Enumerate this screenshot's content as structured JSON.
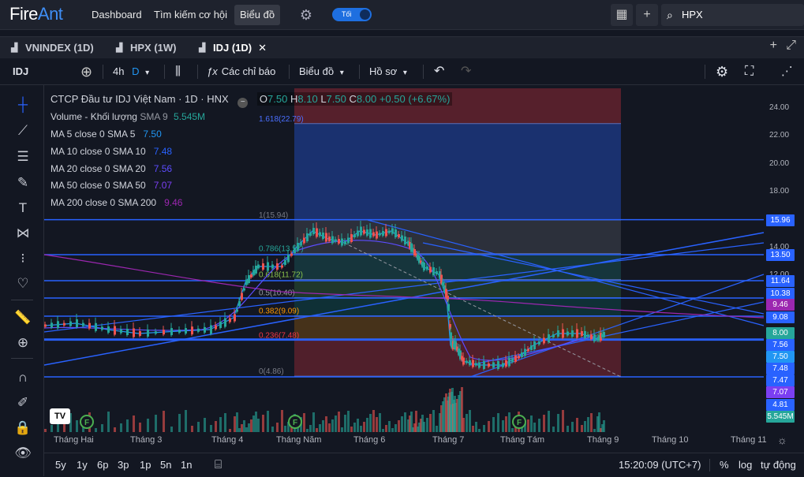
{
  "app": {
    "logo_a": "Fire",
    "logo_b": "Ant"
  },
  "topnav": {
    "dashboard": "Dashboard",
    "screener": "Tìm kiếm cơ hội",
    "chart": "Biểu đồ",
    "theme_toggle": "Tối"
  },
  "search": {
    "value": "HPX",
    "icon": "search-icon"
  },
  "tabs": [
    {
      "label": "VNINDEX (1D)"
    },
    {
      "label": "HPX (1W)"
    },
    {
      "label": "IDJ (1D)"
    }
  ],
  "toolbar": {
    "symbol": "IDJ",
    "interval": "4h",
    "interval_suffix": "D",
    "indicators": "Các chỉ báo",
    "chart_menu": "Biểu đồ",
    "profile": "Hồ sơ"
  },
  "legend": {
    "title": "CTCP Đầu tư IDJ Việt Nam · 1D · HNX",
    "o_label": "O",
    "o": "7.50",
    "h_label": "H",
    "h": "8.10",
    "l_label": "L",
    "l": "7.50",
    "c_label": "C",
    "c": "8.00",
    "change": "+0.50 (+6.67%)",
    "volume_label": "Volume - Khối lượng",
    "volume_sma": "SMA 9",
    "volume_value": "5.545M",
    "ma": [
      {
        "label": "MA 5 close 0 SMA 5",
        "value": "7.50",
        "color": "#2196f3"
      },
      {
        "label": "MA 10 close 0 SMA 10",
        "value": "7.48",
        "color": "#2962ff"
      },
      {
        "label": "MA 20 close 0 SMA 20",
        "value": "7.56",
        "color": "#5c4cff"
      },
      {
        "label": "MA 50 close 0 SMA 50",
        "value": "7.07",
        "color": "#7b3ff2"
      },
      {
        "label": "MA 200 close 0 SMA 200",
        "value": "9.46",
        "color": "#9c27b0"
      }
    ]
  },
  "fib_labels": [
    "1.618(22.79)",
    "1(15.94)",
    "0.786(13.57)",
    "0.618(11.72)",
    "0.5(10.40)",
    "0.382(9.09)",
    "0.236(7.48)",
    "0(4.86)"
  ],
  "y_ticks": [
    "24.00",
    "22.00",
    "20.00",
    "18.00",
    "14.00",
    "12.00"
  ],
  "price_labels": [
    {
      "text": "15.96",
      "color": "#2962ff"
    },
    {
      "text": "13.50",
      "color": "#2962ff"
    },
    {
      "text": "11.64",
      "color": "#2962ff"
    },
    {
      "text": "10.38",
      "color": "#2962ff"
    },
    {
      "text": "9.46",
      "color": "#9c27b0"
    },
    {
      "text": "9.08",
      "color": "#2962ff"
    },
    {
      "text": "8.00",
      "color": "#26a69a"
    },
    {
      "text": "7.56",
      "color": "#2962ff"
    },
    {
      "text": "7.50",
      "color": "#2196f3"
    },
    {
      "text": "7.48",
      "color": "#2962ff"
    },
    {
      "text": "7.47",
      "color": "#2962ff"
    },
    {
      "text": "7.07",
      "color": "#7b3ff2"
    },
    {
      "text": "4.81",
      "color": "#2962ff"
    },
    {
      "text": "5.545M",
      "color": "#26a69a"
    }
  ],
  "x_axis": [
    "Tháng Hai",
    "Tháng 3",
    "Tháng 4",
    "Tháng Năm",
    "Tháng 6",
    "Tháng 7",
    "Tháng Tám",
    "Tháng 9",
    "Tháng 10",
    "Tháng 11"
  ],
  "bottom": {
    "ranges": [
      "5y",
      "1y",
      "6p",
      "3p",
      "1p",
      "5n",
      "1n"
    ],
    "time": "15:20:09 (UTC+7)",
    "pct": "%",
    "log": "log",
    "auto": "tự động"
  },
  "chart_data": {
    "type": "candlestick",
    "symbol": "IDJ",
    "interval": "1D",
    "ohlc_last": {
      "open": 7.5,
      "high": 8.1,
      "low": 7.5,
      "close": 8.0
    },
    "approx_close_path": [
      {
        "x": "Tháng Hai",
        "y": 7.6
      },
      {
        "x": "Tháng 3",
        "y": 7.5
      },
      {
        "x": "Tháng 4",
        "y": 8.0
      },
      {
        "x": "Tháng Năm",
        "y": 13.8
      },
      {
        "x": "Tháng 6",
        "y": 15.2
      },
      {
        "x": "Tháng 7",
        "y": 6.4
      },
      {
        "x": "Tháng Tám",
        "y": 6.8
      },
      {
        "x": "Tháng 9",
        "y": 8.0
      }
    ],
    "fibonacci": [
      {
        "level": 1.618,
        "price": 22.79
      },
      {
        "level": 1,
        "price": 15.94
      },
      {
        "level": 0.786,
        "price": 13.57
      },
      {
        "level": 0.618,
        "price": 11.72
      },
      {
        "level": 0.5,
        "price": 10.4
      },
      {
        "level": 0.382,
        "price": 9.09
      },
      {
        "level": 0.236,
        "price": 7.48
      },
      {
        "level": 0,
        "price": 4.86
      }
    ],
    "horizontal_lines": [
      15.96,
      13.5,
      11.64,
      10.38,
      9.08,
      7.56,
      7.48,
      4.81
    ],
    "y_range": [
      4.0,
      25.0
    ]
  }
}
